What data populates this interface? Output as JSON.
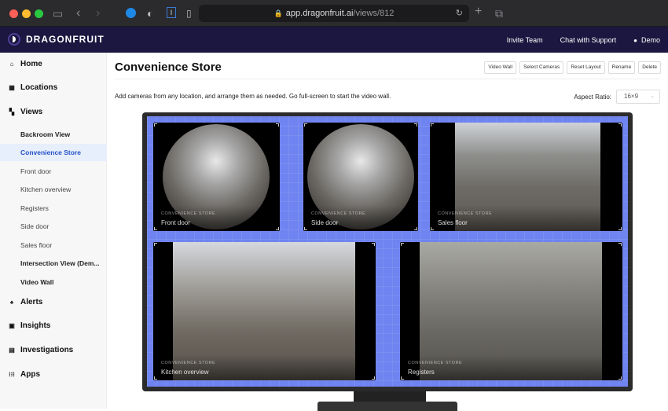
{
  "browser": {
    "url_domain": "app.dragonfruit.ai",
    "url_path": "/views/812",
    "icons": [
      "sidebar-toggle-icon",
      "back-icon",
      "forward-icon",
      "adblock-icon",
      "shield-icon",
      "bitwarden-icon",
      "extension-icon",
      "reload-icon",
      "new-tab-icon",
      "tabs-overview-icon"
    ]
  },
  "topbar": {
    "brand": "DRAGONFRUIT",
    "links": {
      "invite": "Invite Team",
      "chat": "Chat with Support",
      "user": "Demo"
    }
  },
  "sidebar": {
    "main": [
      {
        "label": "Home",
        "icon": "home-icon"
      },
      {
        "label": "Locations",
        "icon": "building-icon"
      },
      {
        "label": "Views",
        "icon": "grid-icon"
      },
      {
        "label": "Alerts",
        "icon": "bell-icon"
      },
      {
        "label": "Insights",
        "icon": "chart-icon"
      },
      {
        "label": "Investigations",
        "icon": "clipboard-icon"
      },
      {
        "label": "Apps",
        "icon": "apps-icon"
      }
    ],
    "views": [
      {
        "label": "Backroom View",
        "style": "bold"
      },
      {
        "label": "Convenience Store",
        "style": "active"
      },
      {
        "label": "Front door",
        "style": "normal"
      },
      {
        "label": "Kitchen overview",
        "style": "normal"
      },
      {
        "label": "Registers",
        "style": "normal"
      },
      {
        "label": "Side door",
        "style": "normal"
      },
      {
        "label": "Sales floor",
        "style": "normal"
      },
      {
        "label": "Intersection View (Dem...",
        "style": "bold"
      },
      {
        "label": "Video Wall",
        "style": "bold"
      }
    ]
  },
  "main": {
    "title": "Convenience Store",
    "actions": [
      "Video Wall",
      "Select Cameras",
      "Reset Layout",
      "Rename",
      "Delete"
    ],
    "description": "Add cameras from any location, and arrange them as needed. Go full-screen to start the video wall.",
    "aspect_label": "Aspect Ratio:",
    "aspect_value": "16×9"
  },
  "tiles": [
    {
      "location": "CONVENIENCE STORE",
      "camera": "Front door",
      "view": "fisheye"
    },
    {
      "location": "CONVENIENCE STORE",
      "camera": "Side door",
      "view": "fisheye"
    },
    {
      "location": "CONVENIENCE STORE",
      "camera": "Sales floor",
      "view": "wide"
    },
    {
      "location": "CONVENIENCE STORE",
      "camera": "Kitchen overview",
      "view": "wide"
    },
    {
      "location": "CONVENIENCE STORE",
      "camera": "Registers",
      "view": "wide"
    }
  ]
}
